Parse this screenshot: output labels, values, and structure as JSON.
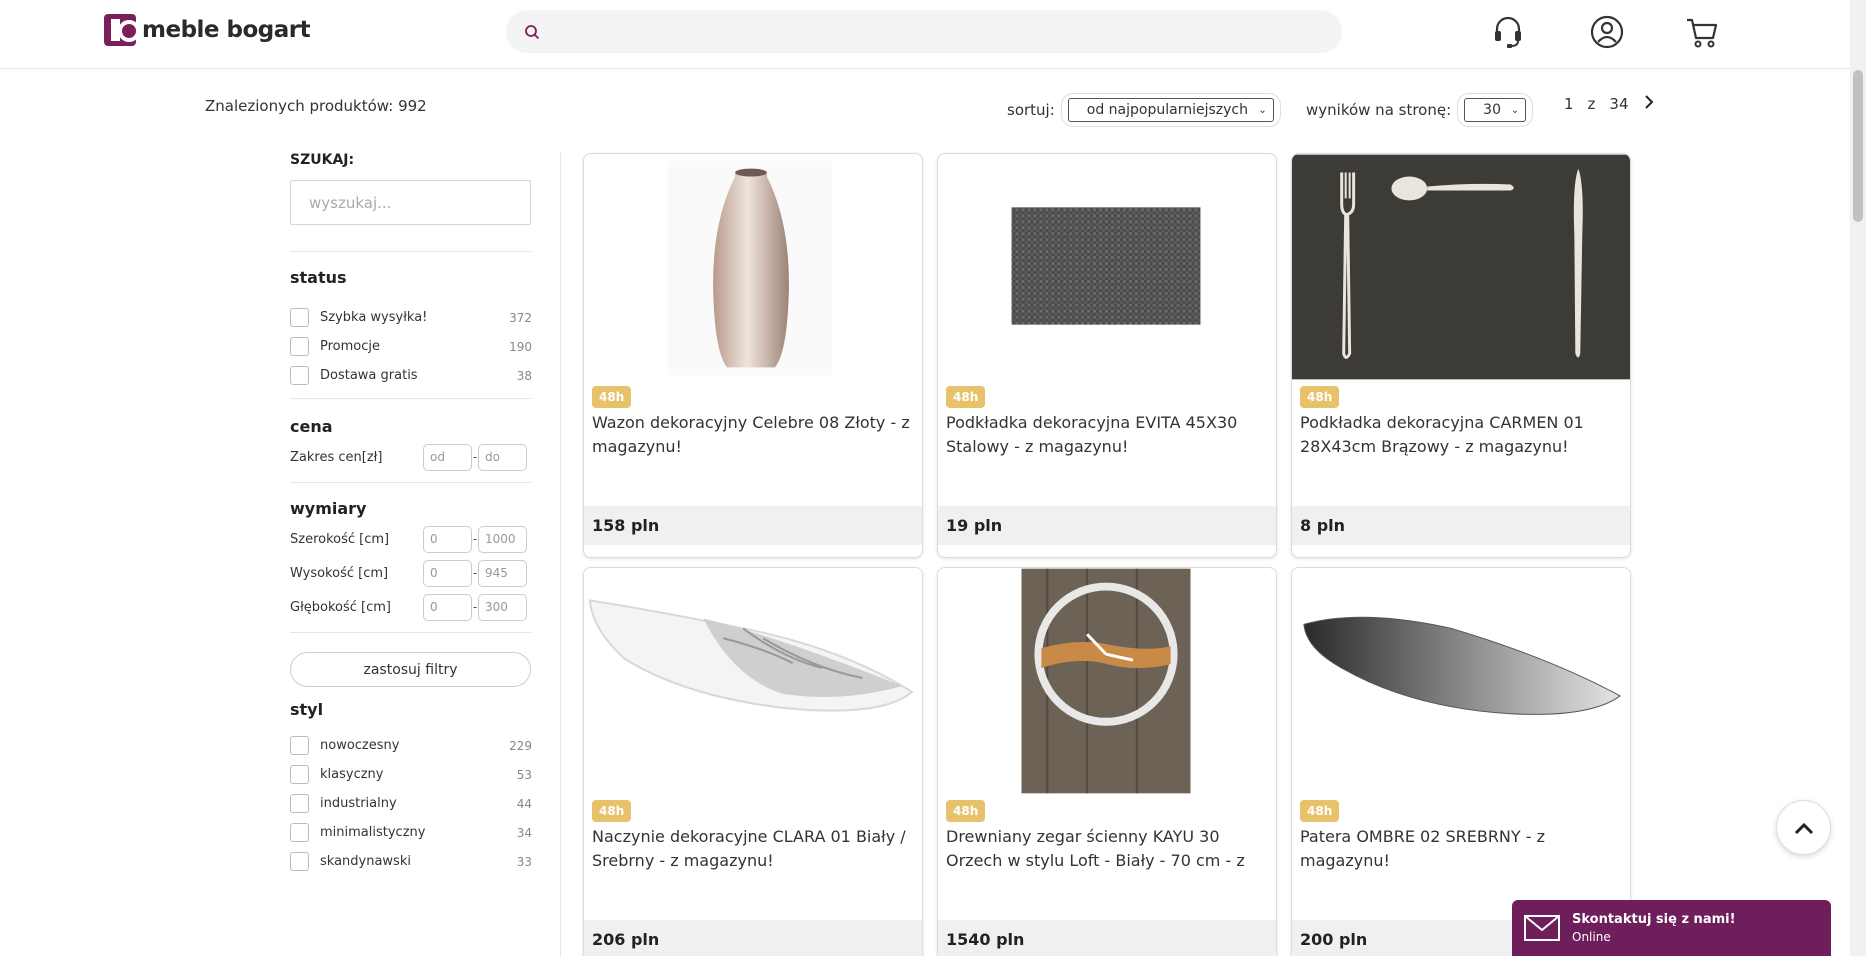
{
  "header": {
    "logo_text": "meble bogart",
    "search_placeholder": ""
  },
  "toolbar": {
    "found_label": "Znalezionych produktów: 992",
    "sort_label": "sortuj:",
    "sort_value": "od najpopularniejszych",
    "per_page_label": "wyników na stronę:",
    "per_page_value": "30",
    "pager_current": "1",
    "pager_of": "z",
    "pager_total": "34"
  },
  "sidebar": {
    "search_label": "SZUKAJ:",
    "search_placeholder": "wyszukaj...",
    "status_heading": "status",
    "status_items": [
      {
        "label": "Szybka wysyłka!",
        "count": "372"
      },
      {
        "label": "Promocje",
        "count": "190"
      },
      {
        "label": "Dostawa gratis",
        "count": "38"
      }
    ],
    "price_heading": "cena",
    "price_label": "Zakres cen[zł]",
    "price_from": "od",
    "price_to": "do",
    "dims_heading": "wymiary",
    "dims": [
      {
        "label": "Szerokość [cm]",
        "from": "0",
        "to": "1000"
      },
      {
        "label": "Wysokość [cm]",
        "from": "0",
        "to": "945"
      },
      {
        "label": "Głębokość [cm]",
        "from": "0",
        "to": "300"
      }
    ],
    "apply_label": "zastosuj filtry",
    "style_heading": "styl",
    "style_items": [
      {
        "label": "nowoczesny",
        "count": "229"
      },
      {
        "label": "klasyczny",
        "count": "53"
      },
      {
        "label": "industrialny",
        "count": "44"
      },
      {
        "label": "minimalistyczny",
        "count": "34"
      },
      {
        "label": "skandynawski",
        "count": "33"
      }
    ]
  },
  "products": [
    {
      "badge": "48h",
      "title": "Wazon dekoracyjny Celebre 08 Złoty - z magazynu!",
      "price": "158 pln"
    },
    {
      "badge": "48h",
      "title": "Podkładka dekoracyjna EVITA 45X30 Stalowy - z magazynu!",
      "price": "19 pln"
    },
    {
      "badge": "48h",
      "title": "Podkładka dekoracyjna CARMEN 01 28X43cm Brązowy - z magazynu!",
      "price": "8 pln"
    },
    {
      "badge": "48h",
      "title": "Naczynie dekoracyjne CLARA 01 Biały / Srebrny - z magazynu!",
      "price": "206 pln"
    },
    {
      "badge": "48h",
      "title": "Drewniany zegar ścienny KAYU 30 Orzech w stylu Loft - Biały - 70 cm - z",
      "price": "1540 pln"
    },
    {
      "badge": "48h",
      "title": "Patera OMBRE 02 SREBRNY - z magazynu!",
      "price": "200 pln"
    }
  ],
  "contact": {
    "title": "Skontaktuj się z nami!",
    "status": "Online"
  },
  "colors": {
    "brand": "#7a1f5c",
    "badge": "#e8c26a",
    "contact_bg": "#6e1e5a"
  }
}
